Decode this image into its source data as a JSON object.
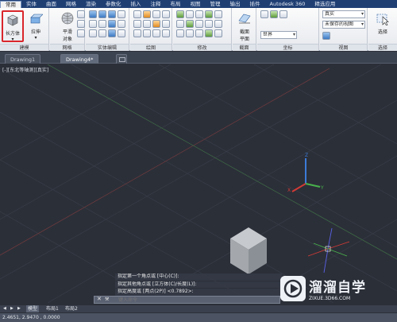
{
  "ribbon_tabs": [
    "常用",
    "实体",
    "曲面",
    "网格",
    "渲染",
    "参数化",
    "插入",
    "注释",
    "布局",
    "视图",
    "管理",
    "输出",
    "插件",
    "Autodesk 360",
    "精选应用"
  ],
  "ribbon": {
    "box_label": "长方体",
    "extrude_label": "拉伸",
    "smooth_label": "平滑",
    "smooth_label2": "对象",
    "section_plane_label": "截面",
    "section_plane_label2": "平面",
    "visual_style": "真实",
    "view_state": "未保存的视图",
    "ucs": "世界",
    "select_label": "选择",
    "panels": [
      "建模",
      "网格",
      "实体编辑",
      "绘图",
      "修改",
      "截面",
      "坐标",
      "视图",
      "选择"
    ]
  },
  "doc_tabs": [
    "Drawing1",
    "Drawing4*"
  ],
  "viewport": {
    "label": "[-][东北等轴测][真实]"
  },
  "command": {
    "history": [
      "指定第一个角点或 [中心(C)]:",
      "指定其他角点或 [立方体(C)/长度(L)]:",
      "指定高度或 [两点(2P)] <0.7892>:"
    ],
    "close_glyph": "✕",
    "input_placeholder": "键入命令"
  },
  "layout_tabs": [
    "模型",
    "布局1",
    "布局2"
  ],
  "status": {
    "coords": "2.4651, 2.9470 , 0.0000"
  },
  "watermark": {
    "title": "溜溜自学",
    "url": "ZIXUE.3D66.COM"
  },
  "colors": {
    "title_bar": "#1f3f73",
    "selected_outline": "#d9262b",
    "viewport_bg": "#2b2f38",
    "cube_top": "#c6c9cd",
    "cube_left": "#a4a8ad",
    "cube_right": "#8b9096"
  }
}
